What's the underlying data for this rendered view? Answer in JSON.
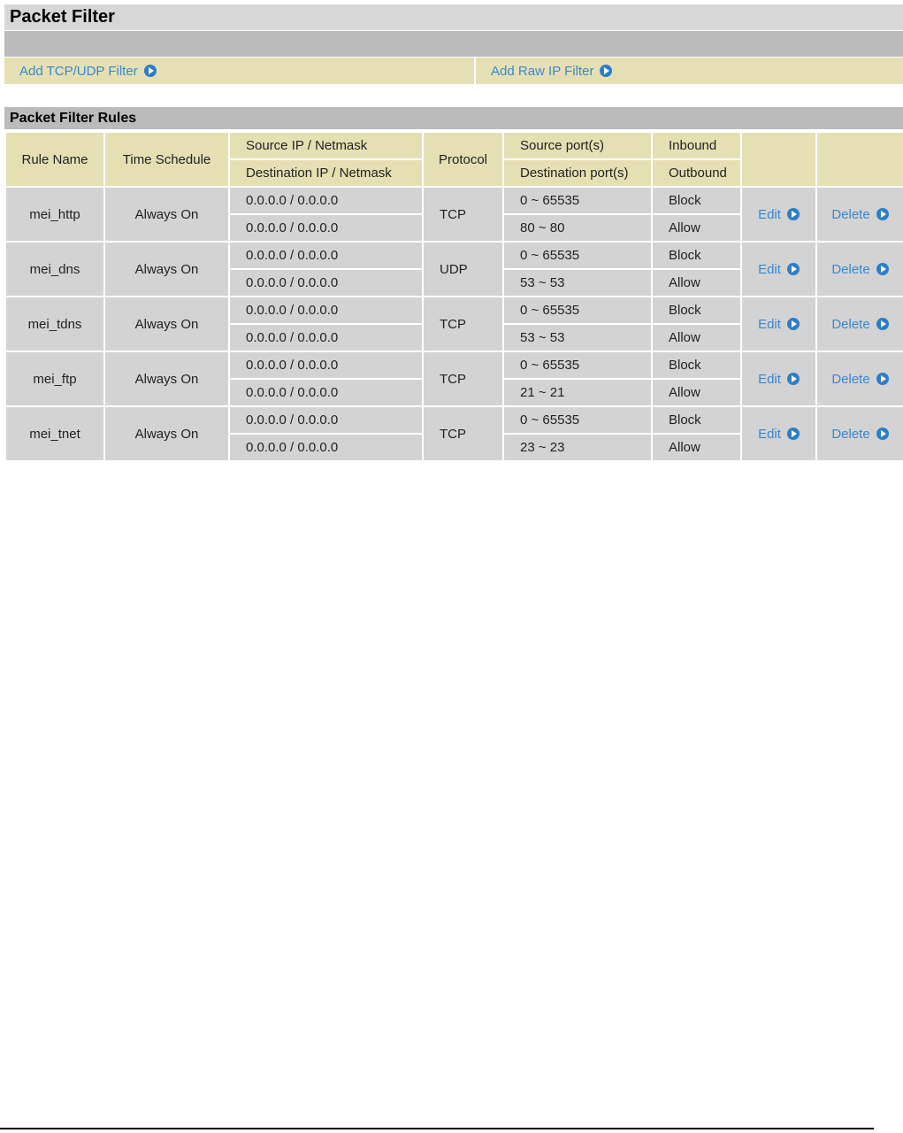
{
  "page": {
    "title": "Packet Filter",
    "add_tcp_udp_label": "Add TCP/UDP Filter",
    "add_raw_ip_label": "Add Raw IP Filter",
    "section_title": "Packet Filter Rules"
  },
  "table": {
    "headers": {
      "rule_name": "Rule Name",
      "time_schedule": "Time Schedule",
      "src_ip": "Source IP / Netmask",
      "dst_ip": "Destination IP / Netmask",
      "protocol": "Protocol",
      "src_port": "Source port(s)",
      "dst_port": "Destination port(s)",
      "inbound": "Inbound",
      "outbound": "Outbound"
    },
    "edit_label": "Edit",
    "delete_label": "Delete",
    "rows": [
      {
        "name": "mei_http",
        "schedule": "Always On",
        "src_ip": "0.0.0.0 / 0.0.0.0",
        "dst_ip": "0.0.0.0 / 0.0.0.0",
        "protocol": "TCP",
        "src_port": "0 ~ 65535",
        "dst_port": "80 ~ 80",
        "inbound": "Block",
        "outbound": "Allow"
      },
      {
        "name": "mei_dns",
        "schedule": "Always On",
        "src_ip": "0.0.0.0 / 0.0.0.0",
        "dst_ip": "0.0.0.0 / 0.0.0.0",
        "protocol": "UDP",
        "src_port": "0 ~ 65535",
        "dst_port": "53 ~ 53",
        "inbound": "Block",
        "outbound": "Allow"
      },
      {
        "name": "mei_tdns",
        "schedule": "Always On",
        "src_ip": "0.0.0.0 / 0.0.0.0",
        "dst_ip": "0.0.0.0 / 0.0.0.0",
        "protocol": "TCP",
        "src_port": "0 ~ 65535",
        "dst_port": "53 ~ 53",
        "inbound": "Block",
        "outbound": "Allow"
      },
      {
        "name": "mei_ftp",
        "schedule": "Always On",
        "src_ip": "0.0.0.0 / 0.0.0.0",
        "dst_ip": "0.0.0.0 / 0.0.0.0",
        "protocol": "TCP",
        "src_port": "0 ~ 65535",
        "dst_port": "21 ~ 21",
        "inbound": "Block",
        "outbound": "Allow"
      },
      {
        "name": "mei_tnet",
        "schedule": "Always On",
        "src_ip": "0.0.0.0 / 0.0.0.0",
        "dst_ip": "0.0.0.0 / 0.0.0.0",
        "protocol": "TCP",
        "src_port": "0 ~ 65535",
        "dst_port": "23 ~ 23",
        "inbound": "Block",
        "outbound": "Allow"
      }
    ]
  },
  "icons": {
    "link_arrow": "circle-arrow-right-icon"
  },
  "colors": {
    "title_bg": "#d7d7d7",
    "strip_bg": "#bbbbbb",
    "header_bg": "#e4e0b4",
    "row_bg": "#d3d3d3",
    "link": "#3a87d0",
    "arrow": "#2c7ec8"
  }
}
